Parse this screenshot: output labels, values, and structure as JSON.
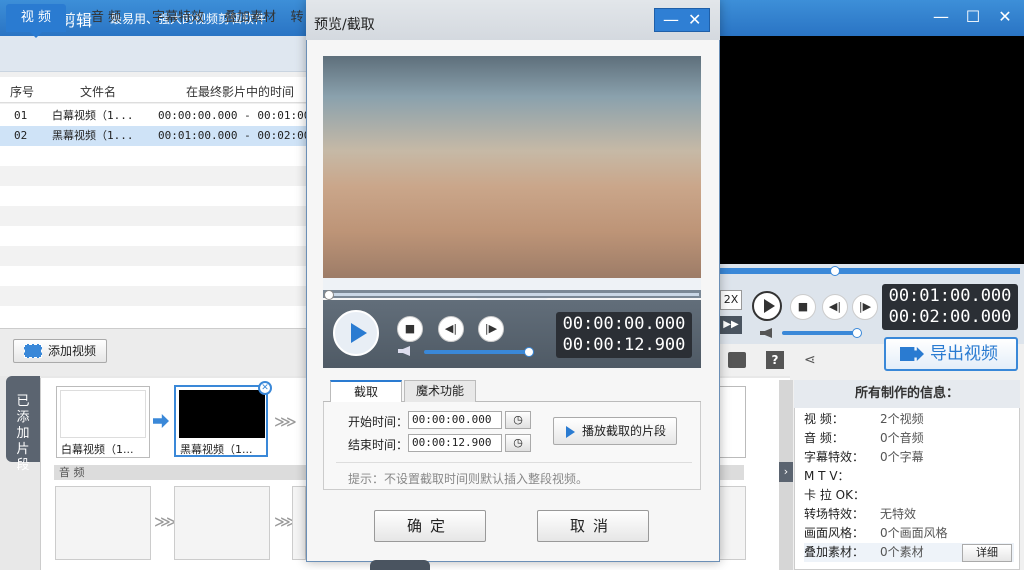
{
  "app": {
    "name": "爱剪辑",
    "slogan": "最易用、强大的视频剪辑软件"
  },
  "window_controls": {
    "minimize": "—",
    "maximize": "☐",
    "close": "✕"
  },
  "tabs": [
    "视  频",
    "音  频",
    "字幕特效",
    "叠加素材",
    "转"
  ],
  "list": {
    "headers": [
      "序号",
      "文件名",
      "在最终影片中的时间"
    ],
    "rows": [
      {
        "no": "01",
        "name": "白幕视频（1...",
        "time": "00:00:00.000 - 00:01:00."
      },
      {
        "no": "02",
        "name": "黑幕视频（1...",
        "time": "00:01:00.000 - 00:02:00."
      }
    ]
  },
  "add_video": "添加视频",
  "added_tab": "已添加片段",
  "timeline": {
    "clips": [
      {
        "label": "白幕视频（1..."
      },
      {
        "label": "黑幕视频（1..."
      }
    ],
    "audio_label": "音 频"
  },
  "right": {
    "timecode_current": "00:01:00.000",
    "timecode_total": "00:02:00.000",
    "speed_label": "2X",
    "export": "导出视频"
  },
  "info": {
    "title": "所有制作的信息：",
    "rows": [
      {
        "k": "视    频：",
        "v": "2个视频"
      },
      {
        "k": "音    频：",
        "v": "0个音频"
      },
      {
        "k": "字幕特效：",
        "v": "0个字幕"
      },
      {
        "k": "M  T  V：",
        "v": ""
      },
      {
        "k": "卡 拉 OK：",
        "v": ""
      },
      {
        "k": "转场特效：",
        "v": "无特效"
      },
      {
        "k": "画面风格：",
        "v": "0个画面风格"
      },
      {
        "k": "叠加素材：",
        "v": "0个素材"
      }
    ],
    "detail": "详细"
  },
  "modal": {
    "title": "预览/截取",
    "timecode_current": "00:00:00.000",
    "timecode_total": "00:00:12.900",
    "subtabs": [
      "截取",
      "魔术功能"
    ],
    "start_label": "开始时间：",
    "start_value": "00:00:00.000",
    "end_label": "结束时间：",
    "end_value": "00:00:12.900",
    "play_segment": "播放截取的片段",
    "hint": "提示：不设置截取时间则默认插入整段视频。",
    "ok": "确定",
    "cancel": "取消"
  },
  "colors": {
    "accent": "#2a7bd1"
  }
}
